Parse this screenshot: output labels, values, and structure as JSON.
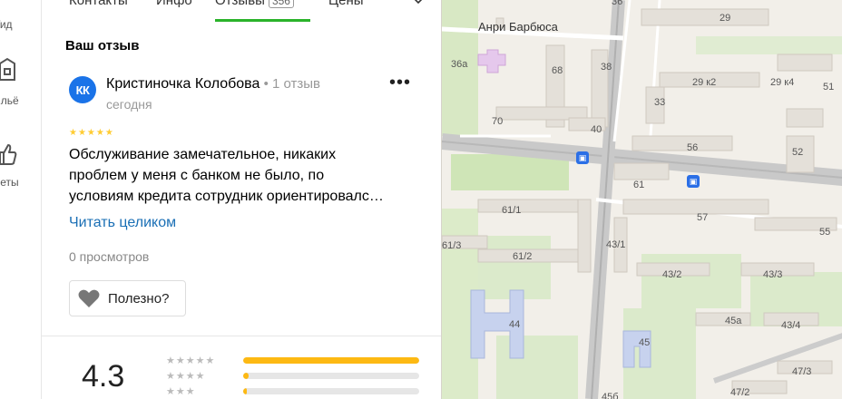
{
  "rail": {
    "items": [
      {
        "label": "Гид"
      },
      {
        "label": "ильё"
      },
      {
        "label": "веты"
      }
    ]
  },
  "tabs": [
    {
      "label": "Контакты"
    },
    {
      "label": "Инфо"
    },
    {
      "label": "Отзывы",
      "count": "356"
    },
    {
      "label": "Цены"
    }
  ],
  "review": {
    "section_title": "Ваш отзыв",
    "avatar_initials": "КК",
    "author": "Кристиночка Колобова",
    "author_meta": " • 1 отзыв",
    "date": "сегодня",
    "stars": "★★★★★",
    "more": "•••",
    "text_lines": [
      "Обслуживание замечательное, никаких",
      "проблем у меня с банком не было, по",
      "условиям кредита сотрудник ориентировалс…"
    ],
    "read_more": "Читать целиком",
    "views": "0 просмотров",
    "useful_label": "Полезно?"
  },
  "rating": {
    "value": "4.3",
    "rows": [
      {
        "stars": "★★★★★",
        "fraction": 1.0
      },
      {
        "stars": "★★★★",
        "fraction": 0.03
      },
      {
        "stars": "★★★",
        "fraction": 0.02
      }
    ]
  },
  "map": {
    "street": "Анри Барбюса",
    "bus_icon": "bus-stop-icon",
    "labels": [
      "36",
      "29",
      "36а",
      "68",
      "38",
      "29 к2",
      "29 к4",
      "33",
      "70",
      "40",
      "56",
      "52",
      "51",
      "61",
      "61/1",
      "57",
      "55",
      "61/3",
      "43/1",
      "61/2",
      "43/2",
      "43/3",
      "44",
      "45а",
      "43/4",
      "45",
      "47/3",
      "47/2",
      "45б"
    ]
  },
  "colors": {
    "accent_green": "#2ab32a",
    "link_blue": "#1a6fb5",
    "avatar_blue": "#1a73e8",
    "rating_yellow": "#fdb913",
    "star_yellow": "#ffcc33"
  }
}
